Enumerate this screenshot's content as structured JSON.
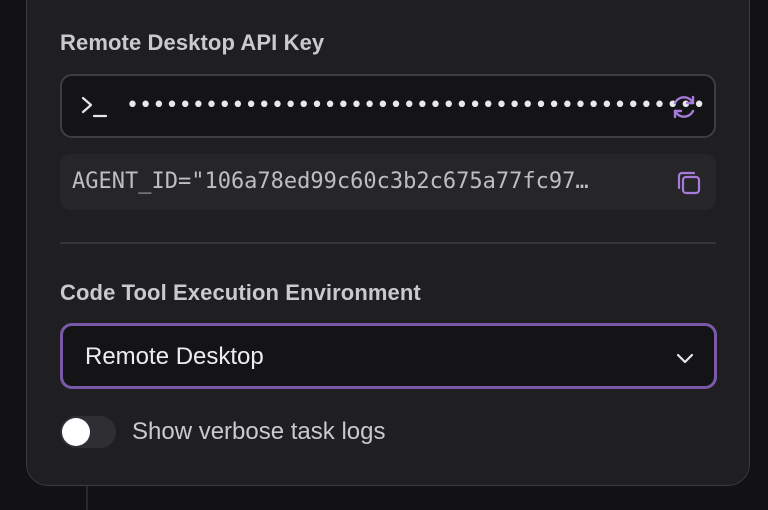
{
  "api_key_section": {
    "label": "Remote Desktop API Key",
    "masked_value": "••••••••••••••••••••••••••••••••••••••••••••",
    "prompt_icon": "terminal-prompt-icon",
    "refresh_icon": "refresh-icon"
  },
  "env_line": {
    "value": "AGENT_ID=\"106a78ed99c60c3b2c675a77fc97…",
    "copy_icon": "copy-icon"
  },
  "execution_section": {
    "label": "Code Tool Execution Environment",
    "selected": "Remote Desktop",
    "chevron_icon": "chevron-down-icon"
  },
  "verbose_toggle": {
    "label": "Show verbose task logs",
    "enabled": false
  },
  "colors": {
    "accent": "#a77bdc",
    "select_border": "#7a5aa8",
    "panel_bg": "#1f1f22",
    "field_bg": "#141416"
  }
}
